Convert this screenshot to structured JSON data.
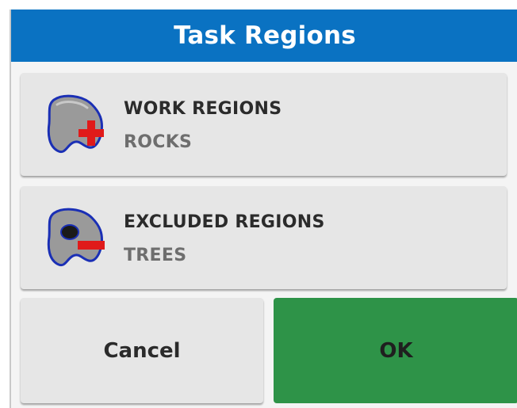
{
  "dialog": {
    "title": "Task Regions",
    "colors": {
      "header": "#0a72c2",
      "ok_button": "#2e9348",
      "button": "#e6e6e6"
    }
  },
  "regions": [
    {
      "name": "WORK REGIONS",
      "value": "ROCKS",
      "icon": "work-region-add-icon"
    },
    {
      "name": "EXCLUDED REGIONS",
      "value": "TREES",
      "icon": "excluded-region-remove-icon"
    }
  ],
  "actions": {
    "cancel_label": "Cancel",
    "ok_label": "OK"
  }
}
